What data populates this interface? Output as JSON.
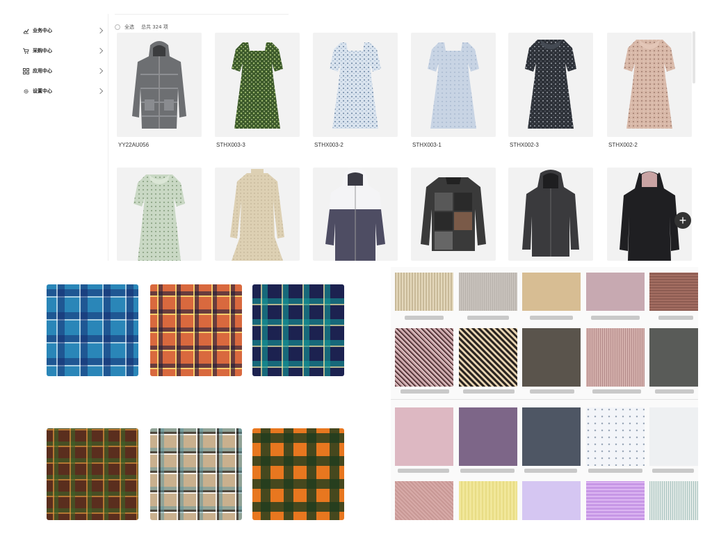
{
  "sidebar": {
    "items": [
      {
        "label": "业务中心",
        "icon": "chart-icon"
      },
      {
        "label": "采购中心",
        "icon": "cart-icon"
      },
      {
        "label": "应用中心",
        "icon": "grid-icon"
      },
      {
        "label": "设置中心",
        "icon": "gear-icon"
      }
    ]
  },
  "toolbar": {
    "select_all": "全选",
    "total": "总共 324 项"
  },
  "products": [
    {
      "code": "YY22AU056"
    },
    {
      "code": "STHX003-3"
    },
    {
      "code": "STHX003-2"
    },
    {
      "code": "STHX003-1"
    },
    {
      "code": "STHX002-3"
    },
    {
      "code": "STHX002-2"
    }
  ],
  "fab": {
    "label": "+"
  },
  "colors": {
    "accent_dark": "#333333",
    "card_bg": "#f2f2f2"
  }
}
